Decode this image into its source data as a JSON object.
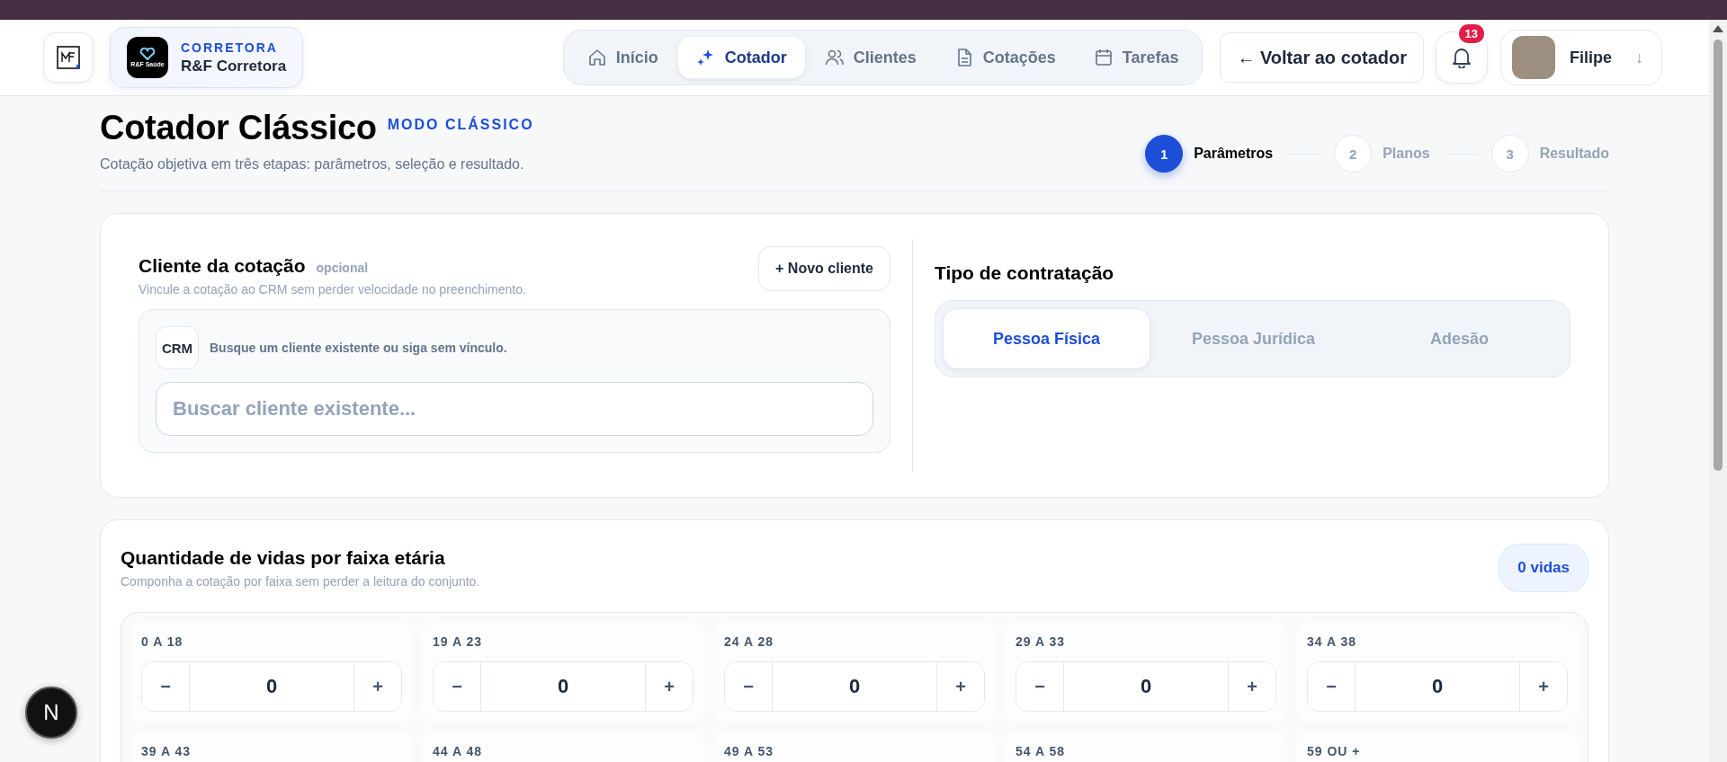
{
  "header": {
    "broker": {
      "eyebrow": "CORRETORA",
      "name": "R&F Corretora",
      "logo_text": "R&F Saúde"
    },
    "nav": [
      {
        "label": "Início",
        "kind": "home",
        "selected": false
      },
      {
        "label": "Cotador",
        "kind": "quoter",
        "selected": true
      },
      {
        "label": "Clientes",
        "kind": "clients",
        "selected": false
      },
      {
        "label": "Cotações",
        "kind": "quotes",
        "selected": false
      },
      {
        "label": "Tarefas",
        "kind": "tasks",
        "selected": false
      }
    ],
    "back_button": "← Voltar ao cotador",
    "notifications": {
      "count": "13"
    },
    "user": {
      "name": "Filipe",
      "caret": "↓"
    }
  },
  "page": {
    "title": "Cotador Clássico",
    "mode": "MODO CLÁSSICO",
    "subtitle": "Cotação objetiva em três etapas: parâmetros, seleção e resultado.",
    "steps": [
      {
        "number": "1",
        "label": "Parâmetros",
        "selected": true
      },
      {
        "number": "2",
        "label": "Planos",
        "selected": false
      },
      {
        "number": "3",
        "label": "Resultado",
        "selected": false
      }
    ]
  },
  "client": {
    "title": "Cliente da cotação",
    "optional": "opcional",
    "subtitle": "Vincule a cotação ao CRM sem perder velocidade no preenchimento.",
    "new_button": "+ Novo cliente",
    "crm_badge": "CRM",
    "crm_hint": "Busque um cliente existente ou siga sem vínculo.",
    "search": {
      "placeholder": "Buscar cliente existente..."
    }
  },
  "contract_type": {
    "title": "Tipo de contratação",
    "options": [
      {
        "label": "Pessoa Física",
        "selected": true
      },
      {
        "label": "Pessoa Jurídica",
        "selected": false
      },
      {
        "label": "Adesão",
        "selected": false
      }
    ]
  },
  "lives": {
    "title": "Quantidade de vidas por faixa etária",
    "subtitle": "Componha a cotação por faixa sem perder a leitura do conjunto.",
    "total": "0 vidas",
    "ranges": [
      {
        "label": "0 A 18",
        "minus": "−",
        "value": "0",
        "plus": "+"
      },
      {
        "label": "19 A 23",
        "minus": "−",
        "value": "0",
        "plus": "+"
      },
      {
        "label": "24 A 28",
        "minus": "−",
        "value": "0",
        "plus": "+"
      },
      {
        "label": "29 A 33",
        "minus": "−",
        "value": "0",
        "plus": "+"
      },
      {
        "label": "34 A 38",
        "minus": "−",
        "value": "0",
        "plus": "+"
      },
      {
        "label": "39 A 43"
      },
      {
        "label": "44 A 48"
      },
      {
        "label": "49 A 53"
      },
      {
        "label": "54 A 58"
      },
      {
        "label": "59 OU +"
      }
    ]
  },
  "dev_button": {
    "label": "N"
  }
}
